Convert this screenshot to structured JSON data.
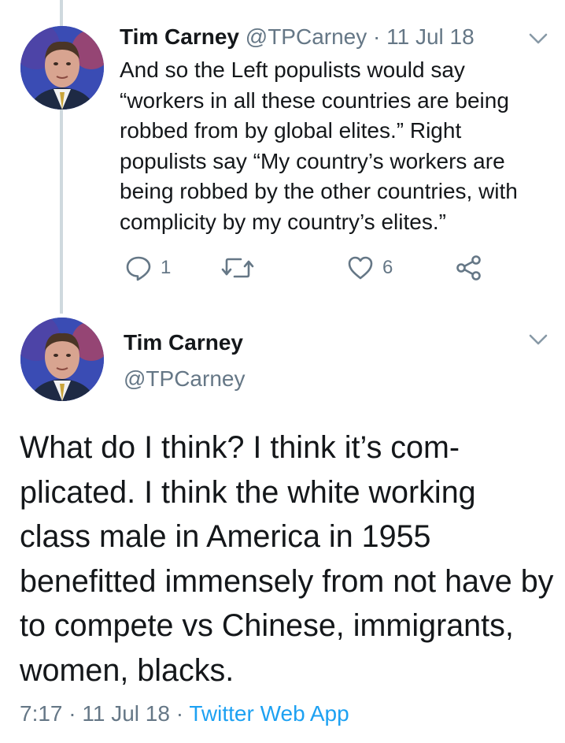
{
  "colors": {
    "text_primary": "#14171a",
    "text_secondary": "#657786",
    "link": "#1da1f2",
    "thread_line": "#cfd9de"
  },
  "reply_tweet": {
    "author_name": "Tim Carney",
    "author_handle": "@TPCarney",
    "separator": "·",
    "date": "11 Jul 18",
    "text": "And so the Left populists would say “workers in all these countries are being robbed from by global elites.” Right populists say “My country’s workers are being robbed by the other countries, with complicity by my country’s elites.”",
    "actions": {
      "reply_icon": "reply-bubble-icon",
      "reply_count": "1",
      "retweet_icon": "retweet-icon",
      "like_icon": "heart-icon",
      "like_count": "6",
      "share_icon": "share-icon"
    },
    "menu_icon": "chevron-down-icon"
  },
  "main_tweet": {
    "author_name": "Tim Carney",
    "author_handle": "@TPCarney",
    "text": "What do I think? I think it’s com-plicated. I think the white working class male in America in 1955 benefitted immensely from not have by to compete vs Chinese, immigrants, women, blacks.",
    "time": "7:17",
    "separator1": "·",
    "date": "11 Jul 18",
    "separator2": "·",
    "source": "Twitter Web App",
    "menu_icon": "chevron-down-icon"
  }
}
